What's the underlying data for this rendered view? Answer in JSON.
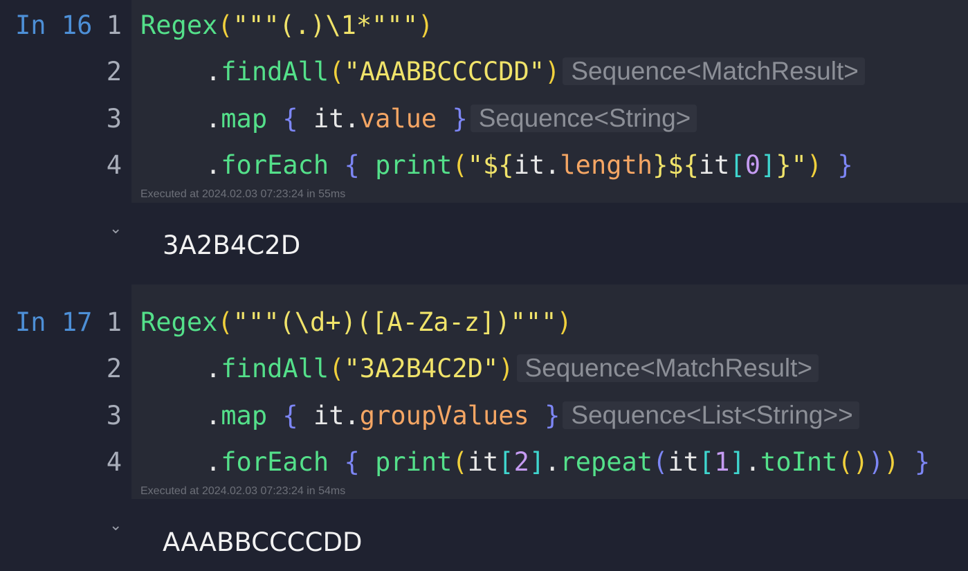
{
  "cells": [
    {
      "label": "In 16",
      "line_numbers": [
        "1",
        "2",
        "3",
        "4"
      ],
      "line1": {
        "fn": "Regex",
        "lp": "(",
        "str": "\"\"\"(.)\\1*\"\"\"",
        "rp": ")"
      },
      "line2": {
        "dot": ".",
        "fn": "findAll",
        "lp": "(",
        "str": "\"AAABBCCCCDD\"",
        "rp": ")",
        "hint": "Sequence<MatchResult>"
      },
      "line3": {
        "dot": ".",
        "fn": "map",
        "lb": "{",
        "it": "it",
        "dot2": ".",
        "prop": "value",
        "rb": "}",
        "hint": "Sequence<String>"
      },
      "line4": {
        "dot": ".",
        "fn": "forEach",
        "lb": "{",
        "fn2": "print",
        "lp": "(",
        "s1": "\"${",
        "it": "it",
        "dot2": ".",
        "prop": "length",
        "s2": "}${",
        "it2": "it",
        "lsq": "[",
        "num": "0",
        "rsq": "]",
        "s3": "}\"",
        "rp": ")",
        "rb": "}"
      },
      "exec": "Executed at 2024.02.03 07:23:24 in 55ms",
      "chevron": "⌄",
      "output": "3A2B4C2D"
    },
    {
      "label": "In 17",
      "line_numbers": [
        "1",
        "2",
        "3",
        "4"
      ],
      "line1": {
        "fn": "Regex",
        "lp": "(",
        "str": "\"\"\"(\\d+)([A-Za-z])\"\"\"",
        "rp": ")"
      },
      "line2": {
        "dot": ".",
        "fn": "findAll",
        "lp": "(",
        "str": "\"3A2B4C2D\"",
        "rp": ")",
        "hint": "Sequence<MatchResult>"
      },
      "line3": {
        "dot": ".",
        "fn": "map",
        "lb": "{",
        "it": "it",
        "dot2": ".",
        "prop": "groupValues",
        "rb": "}",
        "hint": "Sequence<List<String>>"
      },
      "line4": {
        "dot": ".",
        "fn": "forEach",
        "lb": "{",
        "fn2": "print",
        "lp": "(",
        "it": "it",
        "lsq": "[",
        "num": "2",
        "rsq": "]",
        "dot2": ".",
        "fn3": "repeat",
        "lp2": "(",
        "it2": "it",
        "lsq2": "[",
        "num2": "1",
        "rsq2": "]",
        "dot3": ".",
        "fn4": "toInt",
        "lp3": "(",
        "rp3": ")",
        "rp2": ")",
        "rp": ")",
        "rb": "}"
      },
      "exec": "Executed at 2024.02.03 07:23:24 in 54ms",
      "chevron": "⌄",
      "output": "AAABBCCCCDD"
    }
  ],
  "colors": {
    "background": "#1f2230",
    "code_background": "#272a35",
    "label": "#4d8fd6",
    "function": "#54e08a",
    "string": "#f0e36a",
    "paren": "#f0d03c",
    "brace": "#7d86f5",
    "property": "#f5a664",
    "number": "#c59bf2",
    "bracket": "#3fd6cf"
  }
}
